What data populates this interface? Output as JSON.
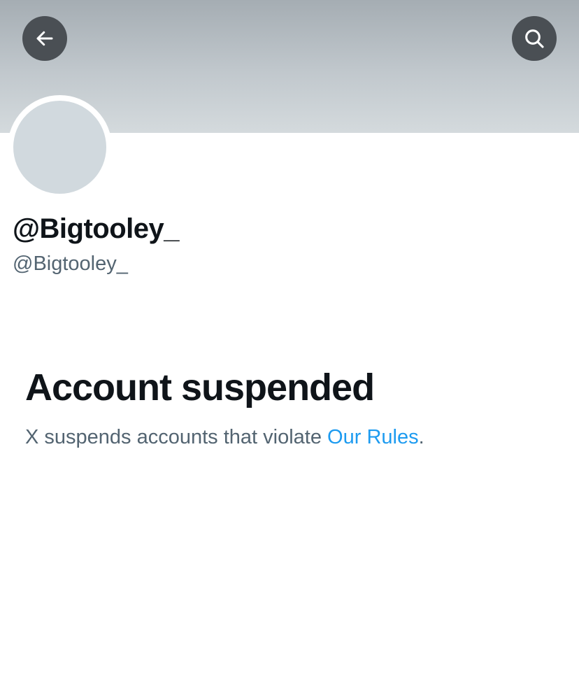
{
  "header": {
    "back_icon": "arrow-left-icon",
    "search_icon": "search-icon"
  },
  "profile": {
    "display_name": "@Bigtooley_",
    "handle": "@Bigtooley_"
  },
  "suspension": {
    "title": "Account suspended",
    "message_prefix": "X suspends accounts that violate ",
    "rules_link": "Our Rules",
    "message_suffix": "."
  },
  "colors": {
    "text_primary": "#0f1419",
    "text_secondary": "#536471",
    "link": "#1d9bf0",
    "icon_button_bg": "#4a4f54",
    "avatar_placeholder": "#d1d9de"
  }
}
